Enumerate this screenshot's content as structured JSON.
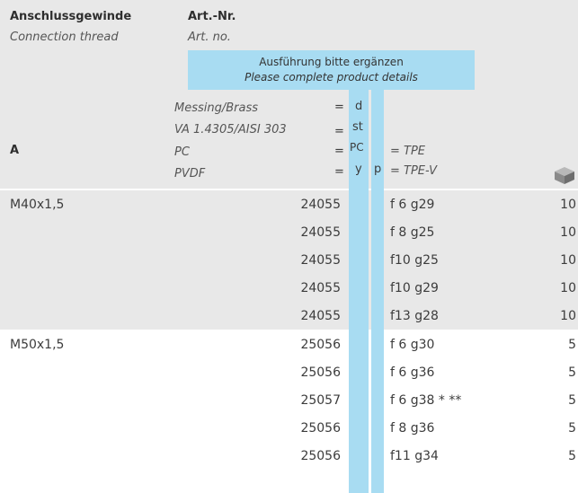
{
  "header": {
    "col_thread_de": "Anschlussgewinde",
    "col_thread_en": "Connection thread",
    "col_art_de": "Art.-Nr.",
    "col_art_en": "Art. no.",
    "band_de": "Ausführung bitte ergänzen",
    "band_en": "Please complete product details",
    "dim_label": "A",
    "materials": [
      {
        "name": "Messing/Brass",
        "eq": "=",
        "code": "d",
        "code2": "",
        "extra": ""
      },
      {
        "name": "VA 1.4305/AISI 303",
        "eq": "=",
        "code": "st",
        "code2": "",
        "extra": ""
      },
      {
        "name": "PC",
        "eq": "=",
        "code": "PC",
        "code2": "",
        "extra": "= TPE"
      },
      {
        "name": "PVDF",
        "eq": "=",
        "code": "y",
        "code2": "p",
        "extra": "= TPE-V"
      }
    ],
    "pack_icon": "package-icon"
  },
  "colors": {
    "header_bg": "#e8e8e8",
    "accent_blue": "#a8dcf2"
  },
  "groups": [
    {
      "thread": "M40x1,5",
      "rows": [
        {
          "art": "24055",
          "spec": "f 6 g29",
          "qty": "10"
        },
        {
          "art": "24055",
          "spec": "f 8 g25",
          "qty": "10"
        },
        {
          "art": "24055",
          "spec": "f10 g25",
          "qty": "10"
        },
        {
          "art": "24055",
          "spec": "f10 g29",
          "qty": "10"
        },
        {
          "art": "24055",
          "spec": "f13 g28",
          "qty": "10"
        }
      ]
    },
    {
      "thread": "M50x1,5",
      "rows": [
        {
          "art": "25056",
          "spec": "f 6 g30",
          "qty": "5"
        },
        {
          "art": "25056",
          "spec": "f 6 g36",
          "qty": "5"
        },
        {
          "art": "25057",
          "spec": "f 6 g38 * **",
          "qty": "5"
        },
        {
          "art": "25056",
          "spec": "f 8 g36",
          "qty": "5"
        },
        {
          "art": "25056",
          "spec": "f11 g34",
          "qty": "5"
        }
      ]
    }
  ]
}
